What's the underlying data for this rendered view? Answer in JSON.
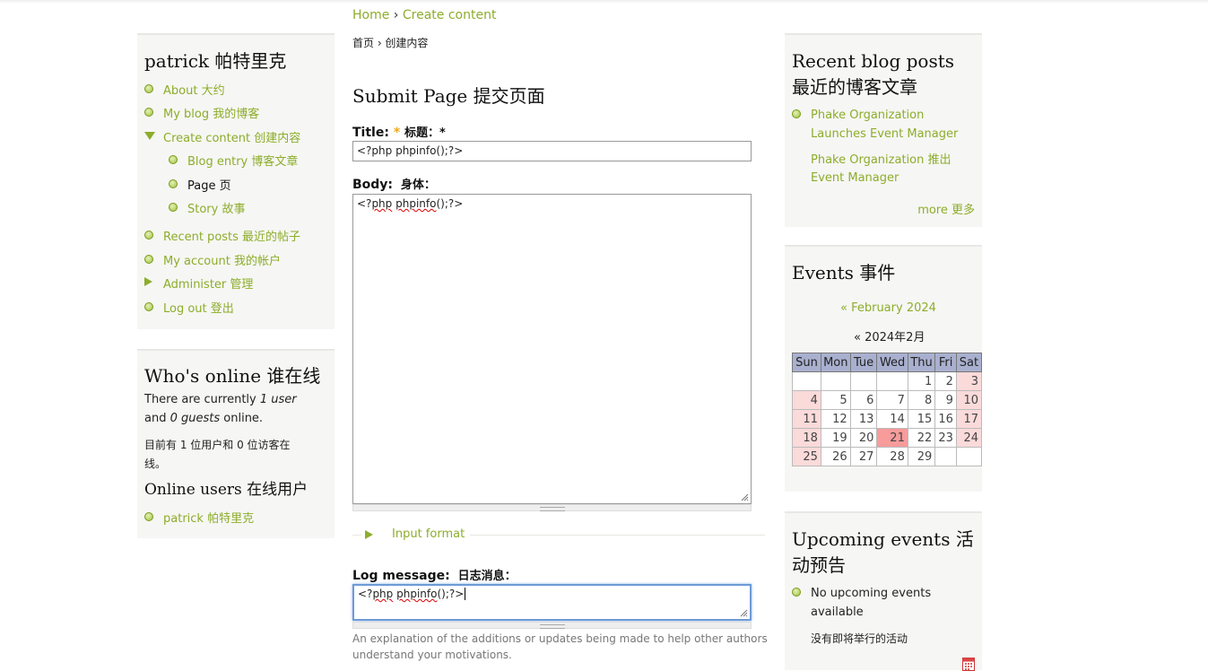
{
  "breadcrumb": {
    "home": "Home",
    "sep": "›",
    "current": "Create content",
    "cn": "首页 › 创建内容"
  },
  "user_block": {
    "title": "patrick  帕特里克",
    "items": [
      {
        "label": "About 大约"
      },
      {
        "label": "My blog 我的博客"
      },
      {
        "label": "Create content 创建内容"
      },
      {
        "label": "Blog entry 博客文章"
      },
      {
        "label": "Page 页"
      },
      {
        "label": "Story 故事"
      },
      {
        "label": "Recent posts 最近的帖子"
      },
      {
        "label": "My account 我的帐户"
      },
      {
        "label": "Administer 管理"
      },
      {
        "label": "Log out 登出"
      }
    ]
  },
  "whos_online": {
    "title": "Who's online  谁在线",
    "line1_a": "There are currently ",
    "line1_b": "1 user",
    "line2_a": "and ",
    "line2_b": "0 guests",
    "line2_c": " online.",
    "cn_line1": "目前有 1 位用户和 0 位访客在",
    "cn_line2": "线。",
    "online_users_title": "Online users 在线用户",
    "online_user": "patrick 帕特里克"
  },
  "form": {
    "heading": "Submit Page 提交页面",
    "title_label": "Title:",
    "title_required": "*",
    "title_cn": "标题：*",
    "title_value": "<?php phpinfo();?>",
    "body_label": "Body:",
    "body_cn": "身体：",
    "body_value_a": "<?",
    "body_value_b": "php",
    "body_value_c": " ",
    "body_value_d": "phpinfo",
    "body_value_e": "();?>",
    "input_format": "Input format",
    "log_label": "Log message:",
    "log_cn": "日志消息：",
    "log_value_a": "<?",
    "log_value_b": "php",
    "log_value_c": " ",
    "log_value_d": "phpinfo",
    "log_value_e": "();?>",
    "log_help": "An explanation of the additions or updates being made to help other authors understand your motivations."
  },
  "recent_posts": {
    "title": "Recent blog posts  最近的博客文章",
    "items": [
      {
        "label": "Phake Organization Launches Event Manager"
      },
      {
        "label": "Phake Organization 推出 Event Manager"
      }
    ],
    "more": "more 更多"
  },
  "events": {
    "title": "Events  事件",
    "month_link": "« February 2024",
    "month_cn": "« 2024年2月",
    "weekdays": [
      "Sun",
      "Mon",
      "Tue",
      "Wed",
      "Thu",
      "Fri",
      "Sat"
    ],
    "weeks": [
      [
        "",
        "",
        "",
        "",
        "1",
        "2",
        "3"
      ],
      [
        "4",
        "5",
        "6",
        "7",
        "8",
        "9",
        "10"
      ],
      [
        "11",
        "12",
        "13",
        "14",
        "15",
        "16",
        "17"
      ],
      [
        "18",
        "19",
        "20",
        "21",
        "22",
        "23",
        "24"
      ],
      [
        "25",
        "26",
        "27",
        "28",
        "29",
        "",
        ""
      ]
    ],
    "today": "21"
  },
  "upcoming": {
    "title": "Upcoming events  活动预告",
    "none": "No upcoming events available",
    "none_cn": "没有即将举行的活动"
  },
  "colors": {
    "link": "#8cad2b",
    "required": "#f0a81b",
    "weekend": "#fbdada",
    "today": "#f79b9b",
    "calendar_header": "#a9b0cf"
  }
}
